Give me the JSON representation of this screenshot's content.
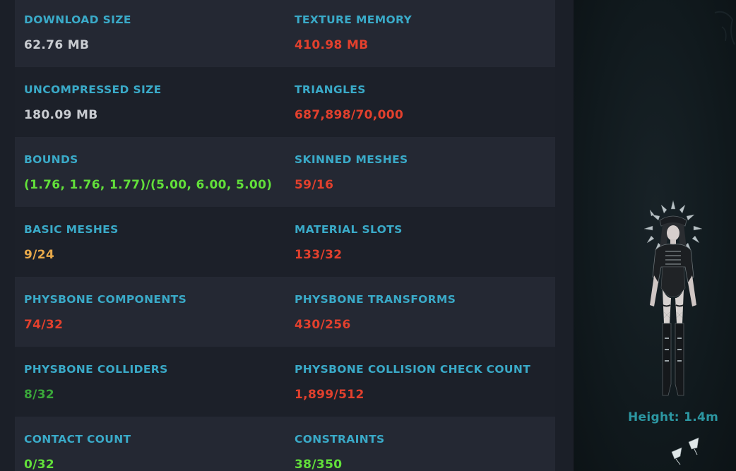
{
  "stats": {
    "rows": [
      {
        "left": {
          "label": "DOWNLOAD SIZE",
          "value": "62.76 MB",
          "status_color": "#c9ccd1"
        },
        "right": {
          "label": "TEXTURE MEMORY",
          "value": "410.98 MB",
          "status_color": "#e2402d"
        }
      },
      {
        "left": {
          "label": "UNCOMPRESSED SIZE",
          "value": "180.09 MB",
          "status_color": "#c9ccd1"
        },
        "right": {
          "label": "TRIANGLES",
          "value": "687,898/70,000",
          "status_color": "#e2402d"
        }
      },
      {
        "left": {
          "label": "BOUNDS",
          "value": "(1.76, 1.76, 1.77)/(5.00, 6.00, 5.00)",
          "status_color": "#62e03a"
        },
        "right": {
          "label": "SKINNED MESHES",
          "value": "59/16",
          "status_color": "#e2402d"
        }
      },
      {
        "left": {
          "label": "BASIC MESHES",
          "value": "9/24",
          "status_color": "#e8a94a"
        },
        "right": {
          "label": "MATERIAL SLOTS",
          "value": "133/32",
          "status_color": "#e2402d"
        }
      },
      {
        "left": {
          "label": "PHYSBONE COMPONENTS",
          "value": "74/32",
          "status_color": "#e2402d"
        },
        "right": {
          "label": "PHYSBONE TRANSFORMS",
          "value": "430/256",
          "status_color": "#e2402d"
        }
      },
      {
        "left": {
          "label": "PHYSBONE COLLIDERS",
          "value": "8/32",
          "status_color": "#3aa83a"
        },
        "right": {
          "label": "PHYSBONE COLLISION CHECK COUNT",
          "value": "1,899/512",
          "status_color": "#e2402d"
        }
      },
      {
        "left": {
          "label": "CONTACT COUNT",
          "value": "0/32",
          "status_color": "#62e03a"
        },
        "right": {
          "label": "CONSTRAINTS",
          "value": "38/350",
          "status_color": "#62e03a"
        }
      }
    ]
  },
  "preview": {
    "height_text": "Height: 1.4m"
  },
  "colors": {
    "label": "#3aaac8",
    "row_shaded": "#242833",
    "row_plain": "#1c2029",
    "height_label": "#2c97a2"
  }
}
